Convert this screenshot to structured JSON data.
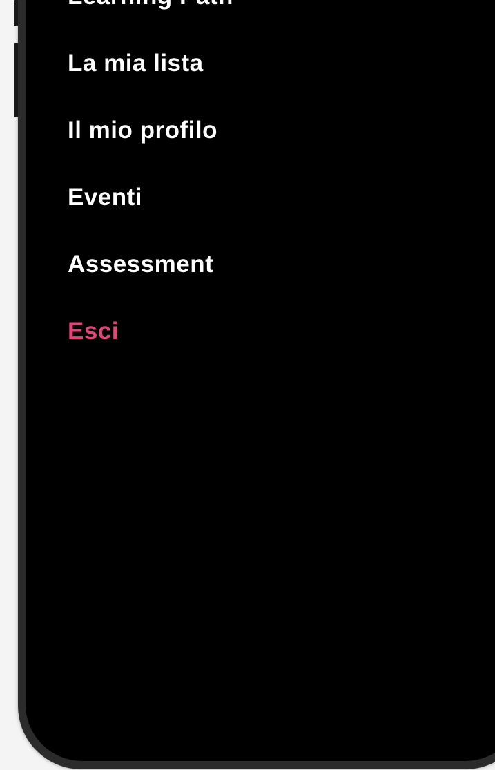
{
  "menu": {
    "items": [
      {
        "label": "Learning Path"
      },
      {
        "label": "La mia lista"
      },
      {
        "label": "Il mio profilo"
      },
      {
        "label": "Eventi"
      },
      {
        "label": "Assessment"
      },
      {
        "label": "Esci"
      }
    ]
  },
  "colors": {
    "background": "#000000",
    "text": "#ffffff",
    "exit_accent": "#e0457b",
    "frame": "#2b2b2b"
  }
}
